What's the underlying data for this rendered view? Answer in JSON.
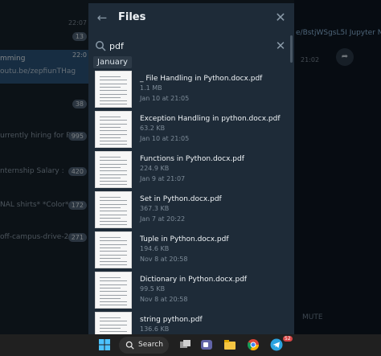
{
  "background": {
    "chats": [
      {
        "text": "",
        "time": "22:07",
        "badge": "13"
      },
      {
        "text": "mming",
        "subtext": "outu.be/zepfiunTHag",
        "time": "22:0",
        "badge": "",
        "active": true
      },
      {
        "text": "",
        "time": "",
        "badge": "38"
      },
      {
        "text": "urrently hiring for Pr...",
        "time": "",
        "badge": "995"
      },
      {
        "text": "nternship Salary :",
        "time": "",
        "badge": "420"
      },
      {
        "text": "NAL shirts* *Color*:...",
        "time": "",
        "badge": "172"
      },
      {
        "text": "off-campus-drive-20...",
        "time": "",
        "badge": "271"
      }
    ],
    "right_link": "e/BstjWSgsL5I Jupyter No",
    "right_time": "21:02",
    "mute_label": "MUTE"
  },
  "modal": {
    "title": "Files",
    "search_value": "pdf",
    "section_label": "January",
    "files": [
      {
        "name": "_ File Handling in Python.docx.pdf",
        "size": "1.1 MB",
        "date": "Jan 10 at 21:05"
      },
      {
        "name": "Exception Handling in python.docx.pdf",
        "size": "63.2 KB",
        "date": "Jan 10 at 21:05"
      },
      {
        "name": "Functions in Python.docx.pdf",
        "size": "224.9 KB",
        "date": "Jan 9 at 21:07"
      },
      {
        "name": "Set in Python.docx.pdf",
        "size": "367.3 KB",
        "date": "Jan 7 at 20:22"
      },
      {
        "name": "Tuple in Python.docx.pdf",
        "size": "194.6 KB",
        "date": "Nov 8 at 20:58"
      },
      {
        "name": "Dictionary in Python.docx.pdf",
        "size": "99.5 KB",
        "date": "Nov 8 at 20:58"
      },
      {
        "name": "string python.pdf",
        "size": "136.6 KB",
        "date": ""
      }
    ]
  },
  "taskbar": {
    "search_label": "Search",
    "telegram_badge": "52"
  }
}
